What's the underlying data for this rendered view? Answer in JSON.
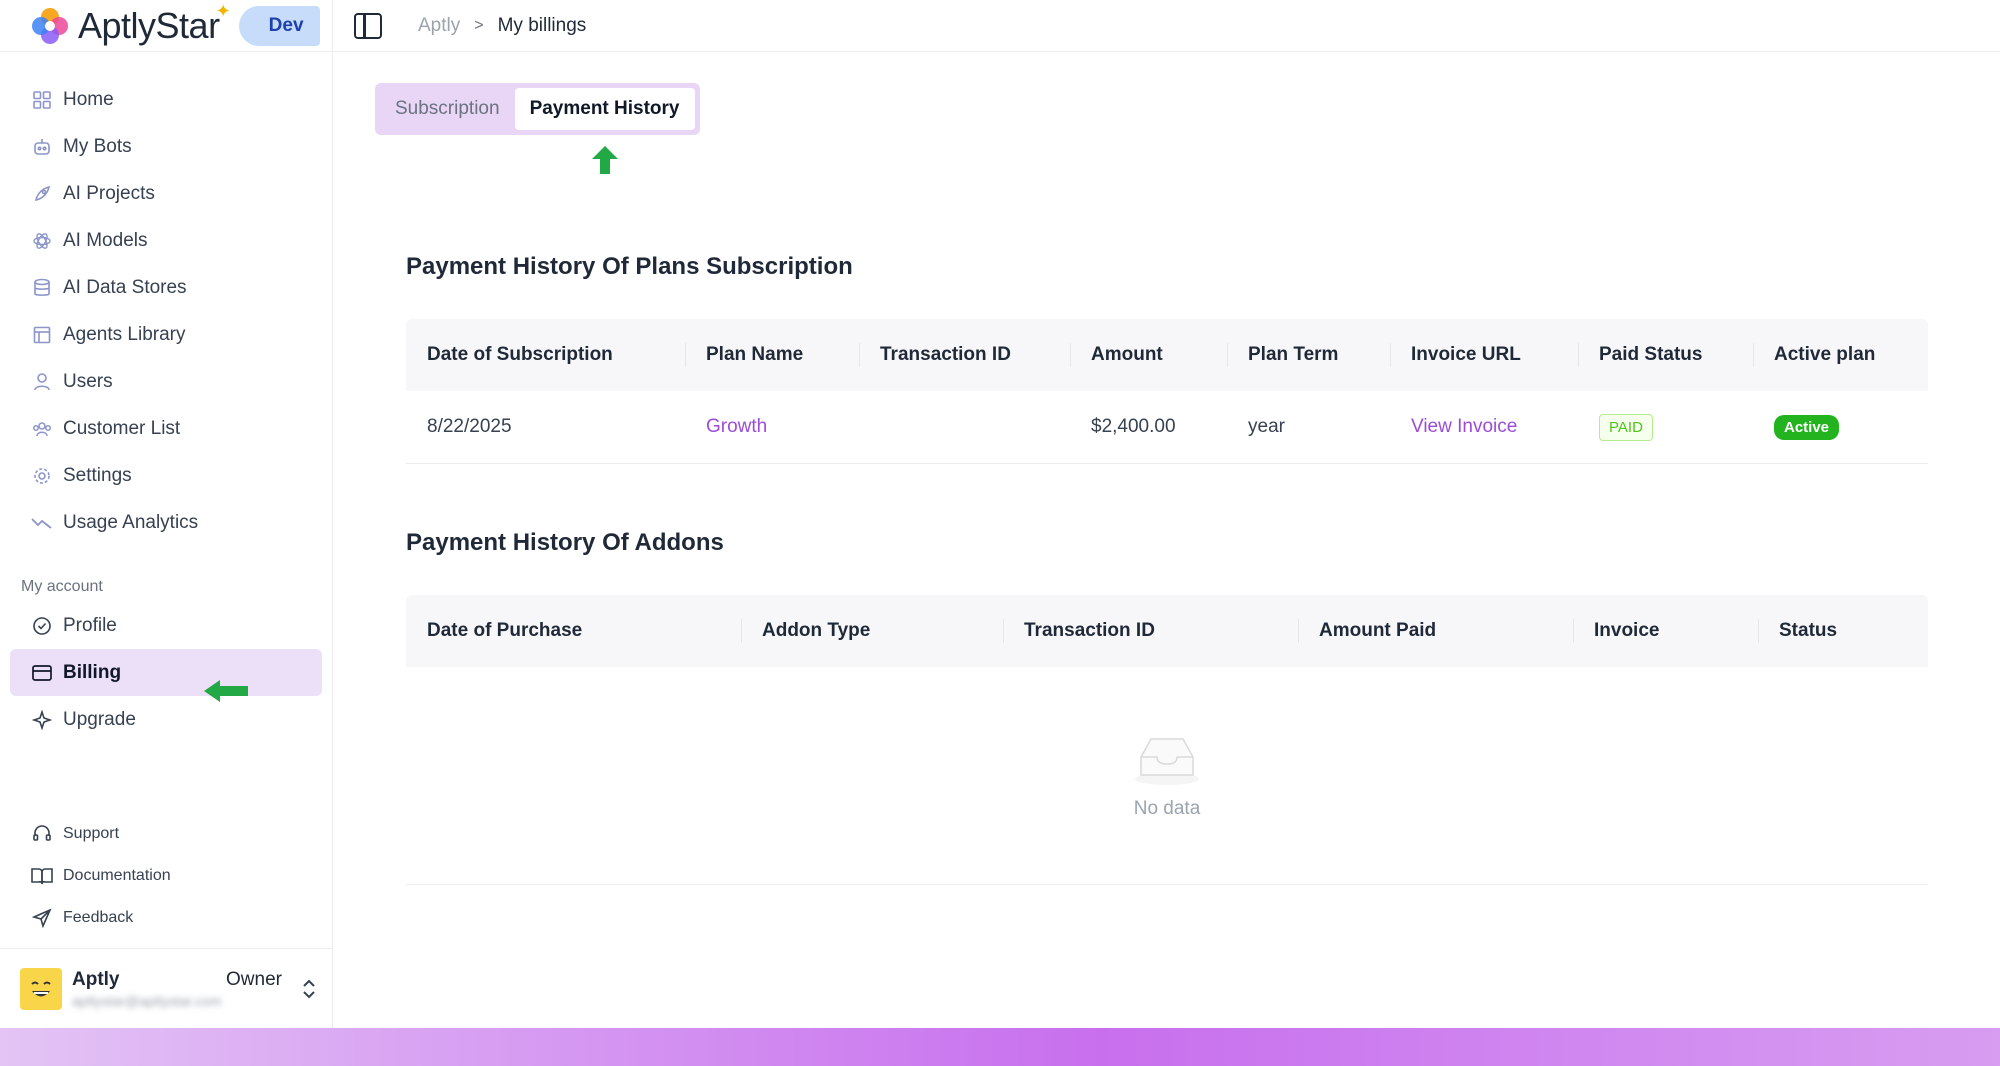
{
  "brand": {
    "name": "AptlyStar",
    "env_badge": "Dev"
  },
  "sidebar": {
    "main_items": [
      {
        "label": "Home",
        "icon": "dashboard-icon"
      },
      {
        "label": "My Bots",
        "icon": "bot-icon"
      },
      {
        "label": "AI Projects",
        "icon": "rocket-icon"
      },
      {
        "label": "AI Models",
        "icon": "atom-icon"
      },
      {
        "label": "AI Data Stores",
        "icon": "database-icon"
      },
      {
        "label": "Agents Library",
        "icon": "library-icon"
      },
      {
        "label": "Users",
        "icon": "user-icon"
      },
      {
        "label": "Customer List",
        "icon": "users-group-icon"
      },
      {
        "label": "Settings",
        "icon": "gear-icon"
      },
      {
        "label": "Usage Analytics",
        "icon": "trend-icon"
      }
    ],
    "account_label": "My account",
    "account_items": [
      {
        "label": "Profile",
        "icon": "check-circle-icon"
      },
      {
        "label": "Billing",
        "icon": "credit-card-icon",
        "active": true
      },
      {
        "label": "Upgrade",
        "icon": "sparkle-icon"
      }
    ],
    "footer_items": [
      {
        "label": "Support",
        "icon": "headset-icon"
      },
      {
        "label": "Documentation",
        "icon": "book-icon"
      },
      {
        "label": "Feedback",
        "icon": "send-icon"
      }
    ],
    "user": {
      "name": "Aptly",
      "email": "aptlystar@aptlystar.com",
      "role": "Owner"
    }
  },
  "header": {
    "breadcrumb_root": "Aptly",
    "breadcrumb_separator": ">",
    "breadcrumb_current": "My billings"
  },
  "tabs": [
    {
      "label": "Subscription",
      "active": false
    },
    {
      "label": "Payment History",
      "active": true
    }
  ],
  "plans_section": {
    "title": "Payment History Of Plans Subscription",
    "columns": [
      "Date of Subscription",
      "Plan Name",
      "Transaction ID",
      "Amount",
      "Plan Term",
      "Invoice URL",
      "Paid Status",
      "Active plan"
    ],
    "rows": [
      {
        "date": "8/22/2025",
        "plan_name": "Growth",
        "transaction_id": "",
        "amount": "$2,400.00",
        "term": "year",
        "invoice": "View Invoice",
        "paid_status": "PAID",
        "active_plan": "Active"
      }
    ]
  },
  "addons_section": {
    "title": "Payment History Of Addons",
    "columns": [
      "Date of Purchase",
      "Addon Type",
      "Transaction ID",
      "Amount Paid",
      "Invoice",
      "Status"
    ],
    "empty_text": "No data"
  },
  "colors": {
    "accent_purple": "#9b4dd8",
    "tab_bg": "#e9d6f7",
    "active_nav_bg": "#ece0f8",
    "success_green": "#22b31f",
    "annotation_arrow": "#22a845"
  }
}
